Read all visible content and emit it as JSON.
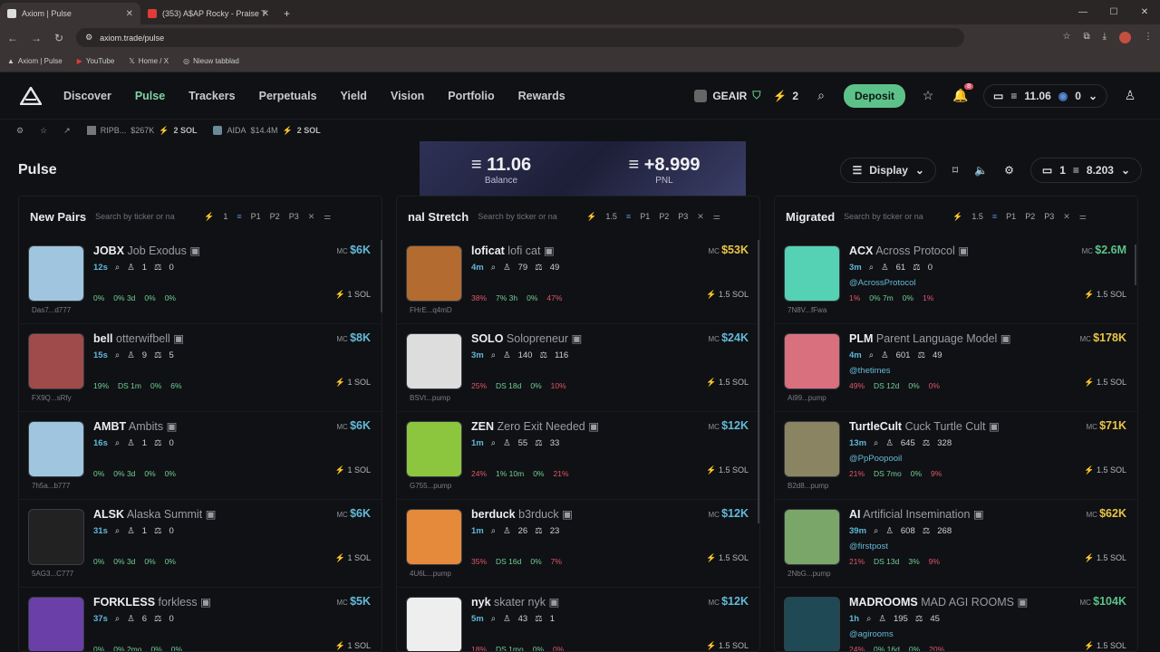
{
  "browser": {
    "tabs": [
      {
        "label": "Axiom | Pulse"
      },
      {
        "label": "(353) A$AP Rocky - Praise T"
      }
    ],
    "url": "axiom.trade/pulse",
    "bookmarks": [
      "Axiom | Pulse",
      "YouTube",
      "Home / X",
      "Nieuw tabblad"
    ]
  },
  "nav": {
    "links": [
      "Discover",
      "Pulse",
      "Trackers",
      "Perpetuals",
      "Yield",
      "Vision",
      "Portfolio",
      "Rewards"
    ],
    "user": "GEAIR",
    "lightning": "2",
    "deposit": "Deposit",
    "notif": "8",
    "balance": "11.06",
    "other": "0"
  },
  "ticker": [
    {
      "name": "RIPB...",
      "mc": "$267K",
      "sol": "2 SOL"
    },
    {
      "name": "AIDA",
      "mc": "$14.4M",
      "sol": "2 SOL"
    }
  ],
  "pulse": {
    "title": "Pulse",
    "balance": "11.06",
    "balance_label": "Balance",
    "pnl": "+8.999",
    "pnl_label": "PNL",
    "display": "Display",
    "wallets": "1",
    "wallet_bal": "8.203"
  },
  "columns": [
    {
      "title": "New Pairs",
      "search": "Search by ticker or na",
      "amount": "1",
      "p1": "P1",
      "p2": "P2",
      "p3": "P3",
      "tokens": [
        {
          "ticker": "JOBX",
          "name": "Job Exodus",
          "age": "12s",
          "holders": "1",
          "pro": "0",
          "addr": "Das7...d777",
          "mc": "$6K",
          "s1": "0%",
          "s2": "0% 3d",
          "s3": "0%",
          "s4": "0%",
          "buy": "1 SOL",
          "color": "#9fc6de"
        },
        {
          "ticker": "bell",
          "name": "otterwifbell",
          "age": "15s",
          "holders": "9",
          "pro": "5",
          "addr": "FX9Q...sRfy",
          "mc": "$8K",
          "s1": "19%",
          "s2": "DS 1m",
          "s3": "0%",
          "s4": "6%",
          "buy": "1 SOL",
          "color": "#a04b4b"
        },
        {
          "ticker": "AMBT",
          "name": "Ambits",
          "age": "16s",
          "holders": "1",
          "pro": "0",
          "addr": "7h5a...b777",
          "mc": "$6K",
          "s1": "0%",
          "s2": "0% 3d",
          "s3": "0%",
          "s4": "0%",
          "buy": "1 SOL",
          "color": "#9fc6de"
        },
        {
          "ticker": "ALSK",
          "name": "Alaska Summit",
          "age": "31s",
          "holders": "1",
          "pro": "0",
          "addr": "5AG3...C777",
          "mc": "$6K",
          "s1": "0%",
          "s2": "0% 3d",
          "s3": "0%",
          "s4": "0%",
          "buy": "1 SOL",
          "color": "#222"
        },
        {
          "ticker": "FORKLESS",
          "name": "forkless",
          "age": "37s",
          "holders": "6",
          "pro": "0",
          "addr": "",
          "mc": "$5K",
          "s1": "0%",
          "s2": "0% 2mo",
          "s3": "0%",
          "s4": "0%",
          "buy": "1 SOL",
          "color": "#6b3fa8"
        }
      ]
    },
    {
      "title": "nal Stretch",
      "search": "Search by ticker or na",
      "amount": "1.5",
      "p1": "P1",
      "p2": "P2",
      "p3": "P3",
      "tokens": [
        {
          "ticker": "loficat",
          "name": "lofi cat",
          "age": "4m",
          "holders": "79",
          "pro": "49",
          "addr": "FHrE...q4mD",
          "mc": "$53K",
          "s1": "38%",
          "s2": "7% 3h",
          "s3": "0%",
          "s4": "47%",
          "buy": "1.5 SOL",
          "color": "#b36b2f"
        },
        {
          "ticker": "SOLO",
          "name": "Solopreneur",
          "age": "3m",
          "holders": "140",
          "pro": "116",
          "addr": "BSVt...pump",
          "mc": "$24K",
          "s1": "25%",
          "s2": "DS 18d",
          "s3": "0%",
          "s4": "10%",
          "buy": "1.5 SOL",
          "color": "#ddd"
        },
        {
          "ticker": "ZEN",
          "name": "Zero Exit Needed",
          "age": "1m",
          "holders": "55",
          "pro": "33",
          "addr": "G755...pump",
          "mc": "$12K",
          "s1": "24%",
          "s2": "1% 10m",
          "s3": "0%",
          "s4": "21%",
          "buy": "1.5 SOL",
          "color": "#8cc63f"
        },
        {
          "ticker": "berduck",
          "name": "b3rduck",
          "age": "1m",
          "holders": "26",
          "pro": "23",
          "addr": "4U6L...pump",
          "mc": "$12K",
          "s1": "35%",
          "s2": "DS 16d",
          "s3": "0%",
          "s4": "7%",
          "buy": "1.5 SOL",
          "color": "#e58a3a"
        },
        {
          "ticker": "nyk",
          "name": "skater nyk",
          "age": "5m",
          "holders": "43",
          "pro": "1",
          "addr": "",
          "mc": "$12K",
          "s1": "18%",
          "s2": "DS 1mo",
          "s3": "0%",
          "s4": "0%",
          "buy": "1.5 SOL",
          "color": "#eee"
        }
      ]
    },
    {
      "title": "Migrated",
      "search": "Search by ticker or na",
      "amount": "1.5",
      "p1": "P1",
      "p2": "P2",
      "p3": "P3",
      "tokens": [
        {
          "ticker": "ACX",
          "name": "Across Protocol",
          "age": "3m",
          "holders": "61",
          "pro": "0",
          "addr": "7N8V...fFwa",
          "mc": "$2.6M",
          "s1": "1%",
          "s2": "0% 7m",
          "s3": "0%",
          "s4": "1%",
          "buy": "1.5 SOL",
          "handle": "@AcrossProtocol",
          "color": "#55d1b4"
        },
        {
          "ticker": "PLM",
          "name": "Parent Language Model",
          "age": "4m",
          "holders": "601",
          "pro": "49",
          "addr": "Ai99...pump",
          "mc": "$178K",
          "s1": "49%",
          "s2": "DS 12d",
          "s3": "0%",
          "s4": "0%",
          "buy": "1.5 SOL",
          "handle": "@thetimes",
          "color": "#d8707e"
        },
        {
          "ticker": "TurtleCult",
          "name": "Cuck Turtle Cult",
          "age": "13m",
          "holders": "645",
          "pro": "328",
          "addr": "B2d8...pump",
          "mc": "$71K",
          "s1": "21%",
          "s2": "DS 7mo",
          "s3": "0%",
          "s4": "9%",
          "buy": "1.5 SOL",
          "handle": "@PpPoopooil",
          "color": "#8b8463"
        },
        {
          "ticker": "AI",
          "name": "Artificial Insemination",
          "age": "39m",
          "holders": "608",
          "pro": "268",
          "addr": "2NbG...pump",
          "mc": "$62K",
          "s1": "21%",
          "s2": "DS 13d",
          "s3": "3%",
          "s4": "9%",
          "buy": "1.5 SOL",
          "handle": "@firstpost",
          "color": "#7ba66a"
        },
        {
          "ticker": "MADROOMS",
          "name": "MAD AGI ROOMS",
          "age": "1h",
          "holders": "195",
          "pro": "45",
          "addr": "",
          "mc": "$104K",
          "s1": "24%",
          "s2": "0% 16d",
          "s3": "0%",
          "s4": "20%",
          "buy": "1.5 SOL",
          "handle": "@agirooms",
          "color": "#1f4a55"
        }
      ]
    }
  ]
}
